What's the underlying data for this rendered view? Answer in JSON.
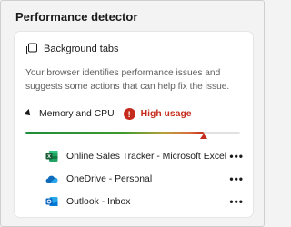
{
  "panel": {
    "title": "Performance detector"
  },
  "card": {
    "title": "Background tabs",
    "title_icon": "tabs-icon",
    "description": "Your browser identifies performance issues and suggests some actions that can help fix the issue."
  },
  "memory": {
    "label": "Memory and CPU",
    "status": "High usage",
    "status_icon": "warning-icon",
    "status_color": "#c42b1c",
    "usage_fraction": 0.83
  },
  "tabs": [
    {
      "label": "Online Sales Tracker - Microsoft Excel",
      "icon": "excel-icon",
      "menu": "•••"
    },
    {
      "label": "OneDrive - Personal",
      "icon": "onedrive-icon",
      "menu": "•••"
    },
    {
      "label": "Outlook - Inbox",
      "icon": "outlook-icon",
      "menu": "•••"
    }
  ],
  "colors": {
    "danger": "#c42b1c",
    "excel": "#1f7244",
    "onedrive": "#0f6cbd",
    "outlook": "#0a64c2"
  }
}
